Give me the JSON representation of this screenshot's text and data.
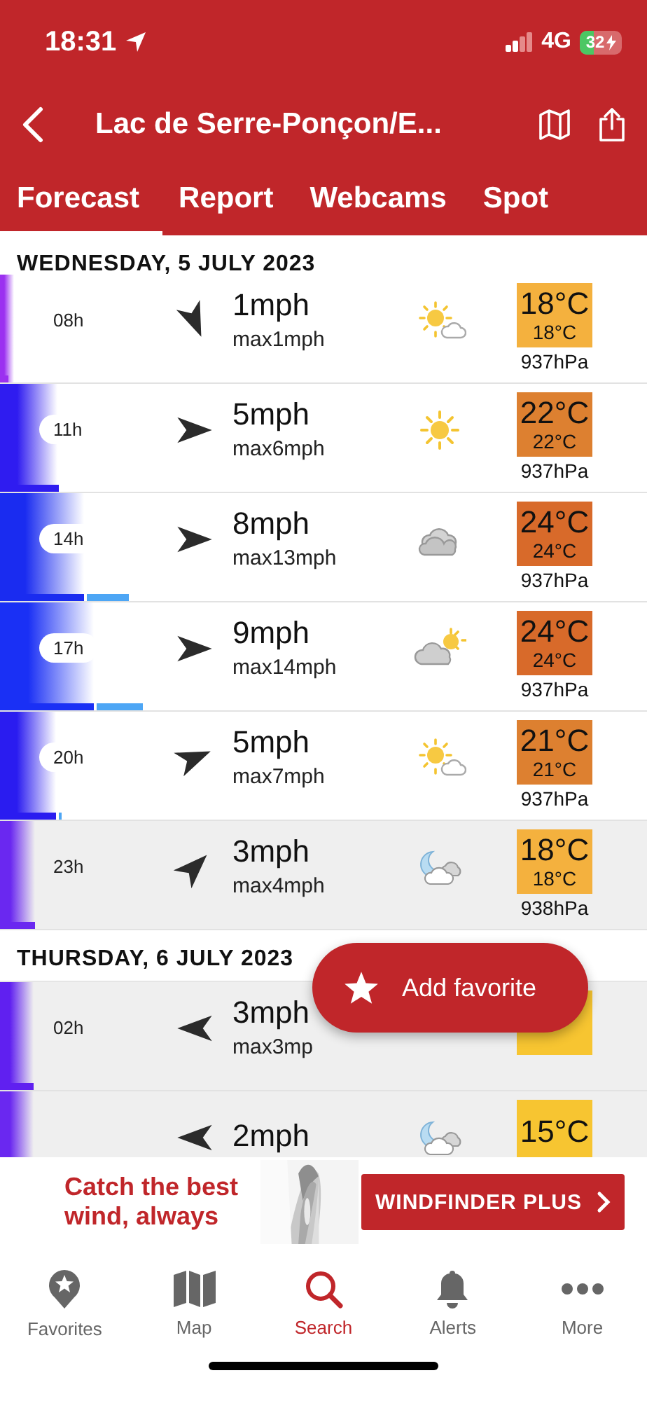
{
  "status_bar": {
    "time": "18:31",
    "network": "4G",
    "battery": "32"
  },
  "header": {
    "title": "Lac de Serre-Ponçon/E..."
  },
  "tabs": [
    {
      "label": "Forecast",
      "selected": true
    },
    {
      "label": "Report",
      "selected": false
    },
    {
      "label": "Webcams",
      "selected": false
    },
    {
      "label": "Spot",
      "selected": false
    }
  ],
  "days": [
    {
      "date": "WEDNESDAY, 5 JULY 2023",
      "rows": [
        {
          "hour": "08h",
          "shaded": false,
          "arrow": {
            "kind": "sse"
          },
          "speed": "1mph",
          "max": "max1mph",
          "icon": {
            "kind": "suncloud"
          },
          "temp_tile": {
            "color": "#f4b13e"
          },
          "temp": "18°C",
          "temp_small": "18°C",
          "pressure": "937hPa",
          "wind_bar": {
            "level": 0.013,
            "color": "#9b30f0"
          }
        },
        {
          "hour": "11h",
          "shaded": false,
          "arrow": {
            "kind": "e"
          },
          "speed": "5mph",
          "max": "max6mph",
          "icon": {
            "kind": "sun"
          },
          "temp_tile": {
            "color": "#dd8030"
          },
          "temp": "22°C",
          "temp_small": "22°C",
          "pressure": "937hPa",
          "wind_bar": {
            "level": 0.09,
            "color": "#2f1cf0"
          }
        },
        {
          "hour": "14h",
          "shaded": false,
          "arrow": {
            "kind": "e"
          },
          "speed": "8mph",
          "max": "max13mph",
          "icon": {
            "kind": "cloud"
          },
          "temp_tile": {
            "color": "#d86a2a"
          },
          "temp": "24°C",
          "temp_small": "24°C",
          "pressure": "937hPa",
          "wind_bar": {
            "level": 0.13,
            "color": "#1a2cf0"
          },
          "gust_bar": {
            "level": 0.2
          }
        },
        {
          "hour": "17h",
          "shaded": false,
          "arrow": {
            "kind": "e"
          },
          "speed": "9mph",
          "max": "max14mph",
          "icon": {
            "kind": "cloudsun"
          },
          "temp_tile": {
            "color": "#d86a2a"
          },
          "temp": "24°C",
          "temp_small": "24°C",
          "pressure": "937hPa",
          "wind_bar": {
            "level": 0.145,
            "color": "#1a30f5"
          },
          "gust_bar": {
            "level": 0.22
          }
        },
        {
          "hour": "20h",
          "shaded": false,
          "arrow": {
            "kind": "ene"
          },
          "speed": "5mph",
          "max": "max7mph",
          "icon": {
            "kind": "suncloud"
          },
          "temp_tile": {
            "color": "#dd8030"
          },
          "temp": "21°C",
          "temp_small": "21°C",
          "pressure": "937hPa",
          "wind_bar": {
            "level": 0.087,
            "color": "#2a1cf0"
          },
          "gust_bar": {
            "level": 0.095
          }
        },
        {
          "hour": "23h",
          "shaded": true,
          "arrow": {
            "kind": "ne"
          },
          "speed": "3mph",
          "max": "max4mph",
          "icon": {
            "kind": "mooncloud"
          },
          "temp_tile": {
            "color": "#f4b13e"
          },
          "temp": "18°C",
          "temp_small": "18°C",
          "pressure": "938hPa",
          "wind_bar": {
            "level": 0.054,
            "color": "#6a28f0"
          }
        }
      ]
    },
    {
      "date": "THURSDAY, 6 JULY 2023",
      "rows": [
        {
          "hour": "02h",
          "shaded": true,
          "arrow": {
            "kind": "w"
          },
          "speed": "3mph",
          "max": "max3mp",
          "temp_tile": {
            "color": "#f7c531"
          },
          "wind_bar": {
            "level": 0.052,
            "color": "#6020f0"
          }
        },
        {
          "shaded": true,
          "arrow": {
            "kind": "w"
          },
          "speed": "2mph",
          "icon": {
            "kind": "mooncloud"
          },
          "temp_tile": {
            "color": "#f7c531"
          },
          "temp": "15°C",
          "wind_bar": {
            "color": "#6a28f0"
          }
        }
      ]
    }
  ],
  "fab": {
    "label": "Add favorite"
  },
  "promo": {
    "text": "Catch the best wind, always",
    "button": "WINDFINDER PLUS"
  },
  "nav": [
    {
      "label": "Favorites",
      "selected": false
    },
    {
      "label": "Map",
      "selected": false
    },
    {
      "label": "Search",
      "selected": true
    },
    {
      "label": "Alerts",
      "selected": false
    },
    {
      "label": "More",
      "selected": false
    }
  ]
}
